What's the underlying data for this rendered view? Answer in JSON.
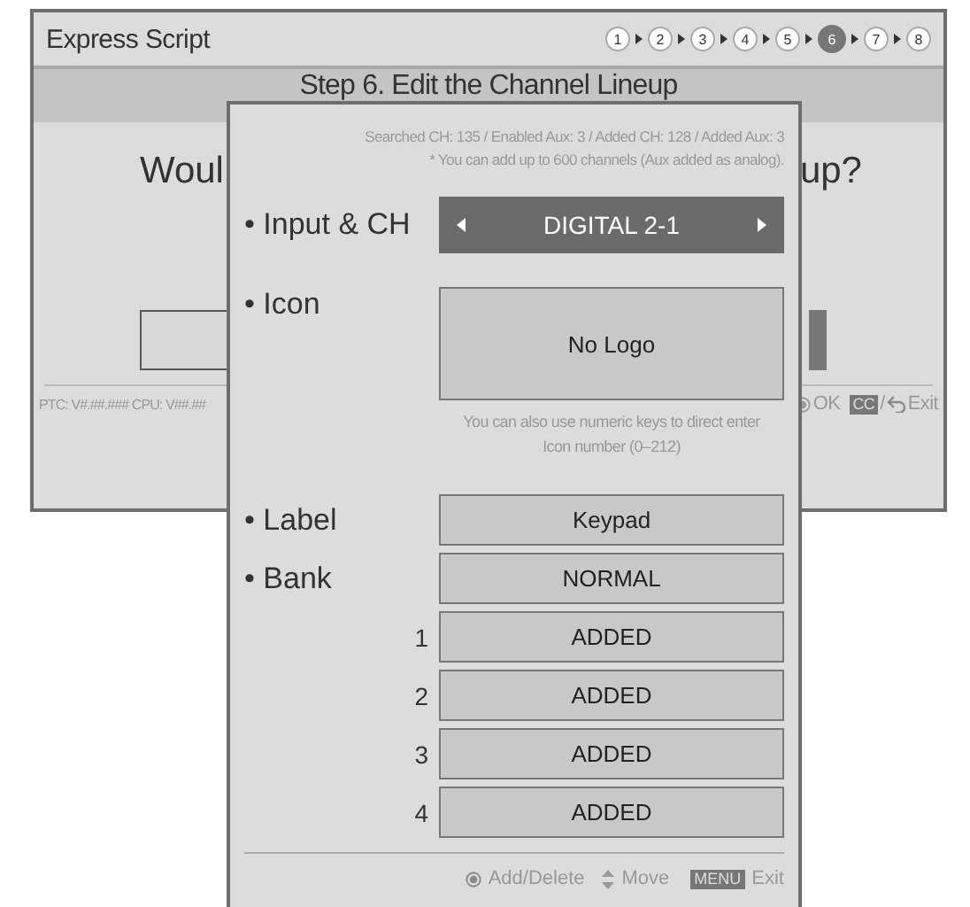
{
  "window": {
    "title": "Express Script"
  },
  "steps": [
    {
      "label": "1",
      "selected": false
    },
    {
      "label": "2",
      "selected": false
    },
    {
      "label": "3",
      "selected": false
    },
    {
      "label": "4",
      "selected": false
    },
    {
      "label": "5",
      "selected": false
    },
    {
      "label": "6",
      "selected": true
    },
    {
      "label": "7",
      "selected": false
    },
    {
      "label": "8",
      "selected": false
    }
  ],
  "step_title": "Step 6. Edit the Channel Lineup",
  "question": {
    "left": "Woul",
    "right": "up?"
  },
  "status_bar": {
    "version": "PTC: V#.##.### CPU: V##.##",
    "ok": "OK",
    "cc_key": "CC",
    "separator": "/",
    "exit": "Exit"
  },
  "dialog": {
    "stats": "Searched CH: 135 / Enabled Aux: 3 / Added CH: 128 / Added Aux: 3",
    "note": "* You can add up to 600 channels (Aux added as analog).",
    "input": {
      "label": "• Input & CH",
      "value": "DIGITAL 2-1"
    },
    "icon": {
      "label": "• Icon",
      "value": "No Logo",
      "hint": "You can also use numeric keys to direct enter Icon number (0–212)"
    },
    "fields": [
      {
        "kind": "labeled",
        "label": "• Label",
        "value": "Keypad"
      },
      {
        "kind": "labeled",
        "label": "• Bank",
        "value": "NORMAL"
      },
      {
        "kind": "numbered",
        "label": "1",
        "value": "ADDED"
      },
      {
        "kind": "numbered",
        "label": "2",
        "value": "ADDED"
      },
      {
        "kind": "numbered",
        "label": "3",
        "value": "ADDED"
      },
      {
        "kind": "numbered",
        "label": "4",
        "value": "ADDED"
      }
    ],
    "footer": {
      "add_delete": "Add/Delete",
      "move": "Move",
      "menu_key": "MENU",
      "exit": "Exit"
    }
  }
}
